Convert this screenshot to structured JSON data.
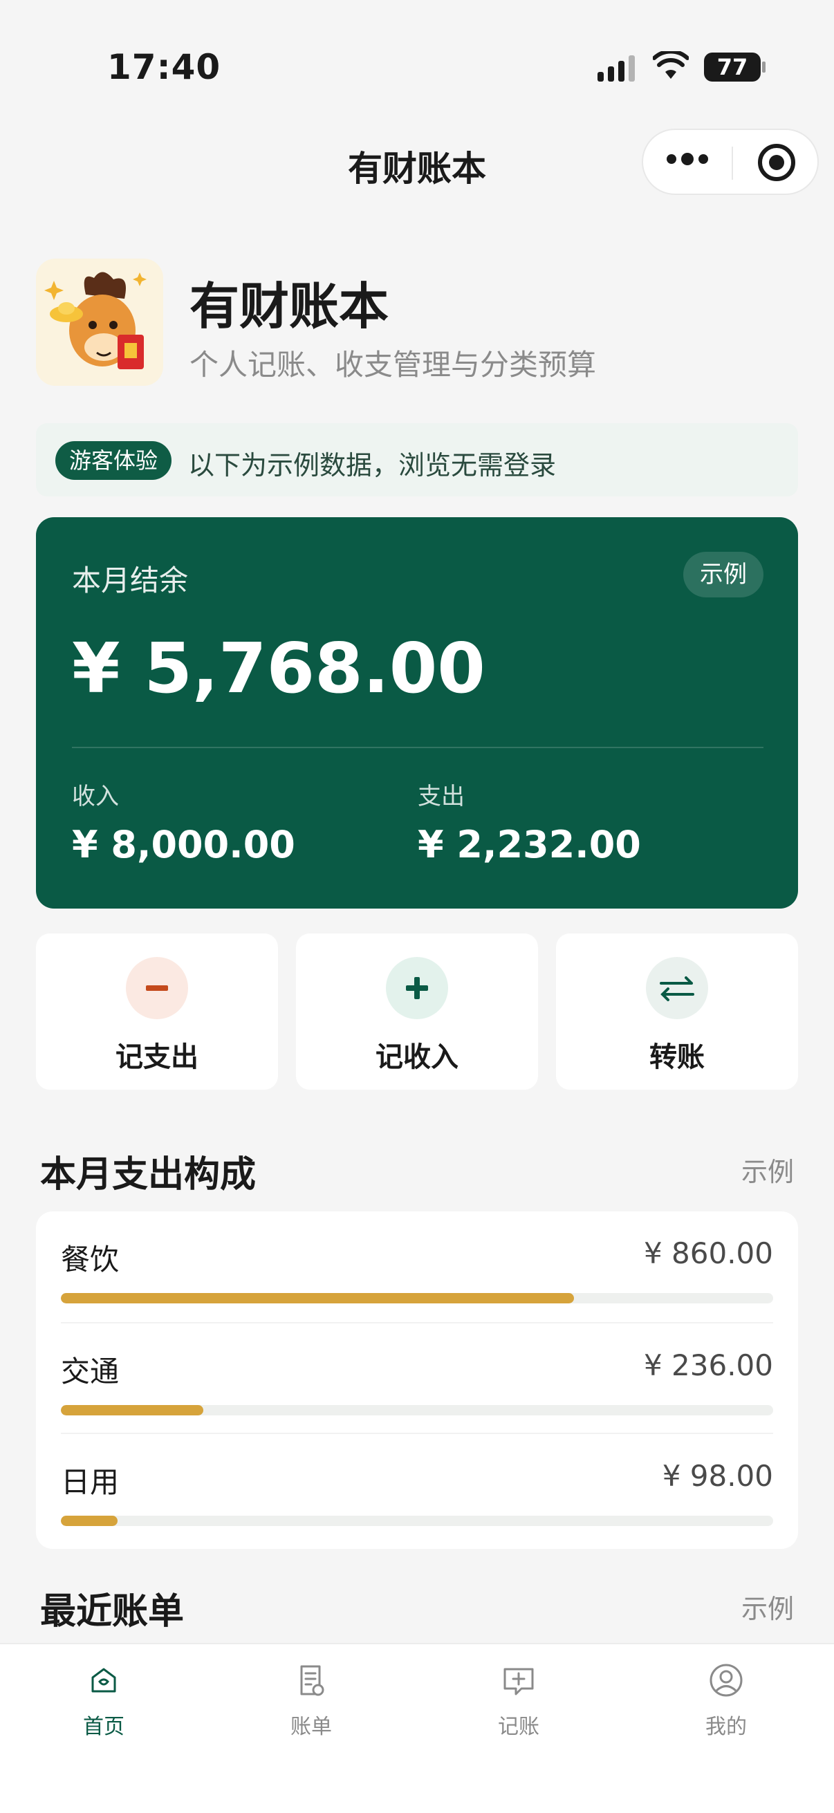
{
  "status_bar": {
    "time": "17:40",
    "battery": "77"
  },
  "nav": {
    "title": "有财账本"
  },
  "header": {
    "app_name": "有财账本",
    "description": "个人记账、收支管理与分类预算"
  },
  "guest_notice": {
    "tag": "游客体验",
    "text": "以下为示例数据，浏览无需登录"
  },
  "balance": {
    "label": "本月结余",
    "tag": "示例",
    "amount": "¥ 5,768.00",
    "income_label": "收入",
    "income_value": "¥ 8,000.00",
    "expense_label": "支出",
    "expense_value": "¥ 2,232.00"
  },
  "actions": [
    {
      "label": "记支出",
      "icon": "minus-icon"
    },
    {
      "label": "记收入",
      "icon": "plus-icon"
    },
    {
      "label": "转账",
      "icon": "transfer-icon"
    }
  ],
  "breakdown": {
    "title": "本月支出构成",
    "tag": "示例",
    "items": [
      {
        "name": "餐饮",
        "value": "¥ 860.00",
        "ratio": 0.72
      },
      {
        "name": "交通",
        "value": "¥ 236.00",
        "ratio": 0.2
      },
      {
        "name": "日用",
        "value": "¥ 98.00",
        "ratio": 0.08
      }
    ]
  },
  "recent": {
    "title": "最近账单",
    "tag": "示例"
  },
  "tabs": [
    {
      "label": "首页",
      "icon": "home-icon",
      "active": true
    },
    {
      "label": "账单",
      "icon": "bill-icon",
      "active": false
    },
    {
      "label": "记账",
      "icon": "record-icon",
      "active": false
    },
    {
      "label": "我的",
      "icon": "profile-icon",
      "active": false
    }
  ],
  "colors": {
    "primary": "#0a5a45",
    "accent": "#d6a33b",
    "expense": "#c44a1c",
    "background": "#f5f5f5"
  }
}
